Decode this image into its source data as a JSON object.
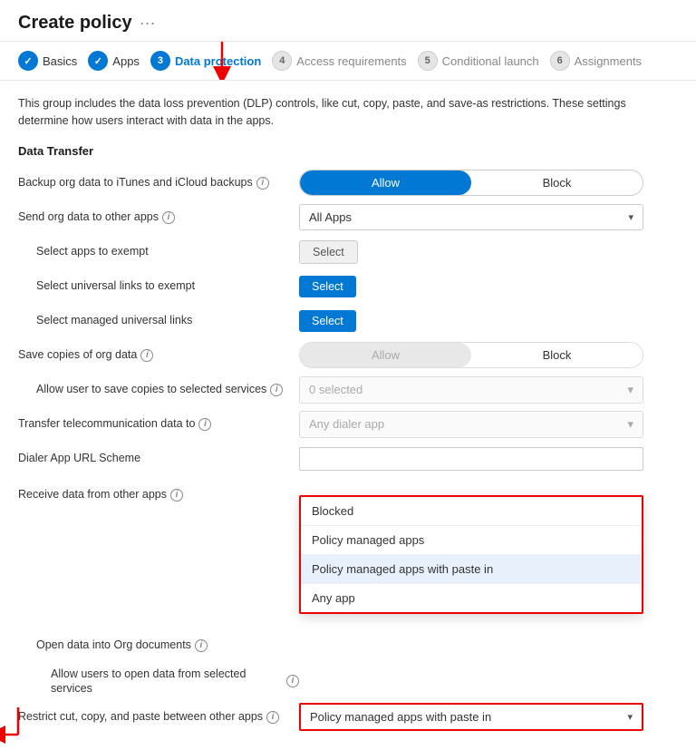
{
  "page": {
    "title": "Create policy",
    "ellipsis": "···"
  },
  "wizard": {
    "steps": [
      {
        "id": "basics",
        "number": "✓",
        "label": "Basics",
        "state": "done"
      },
      {
        "id": "apps",
        "number": "✓",
        "label": "Apps",
        "state": "done"
      },
      {
        "id": "data-protection",
        "number": "3",
        "label": "Data protection",
        "state": "active"
      },
      {
        "id": "access-requirements",
        "number": "4",
        "label": "Access requirements",
        "state": "inactive"
      },
      {
        "id": "conditional-launch",
        "number": "5",
        "label": "Conditional launch",
        "state": "inactive"
      },
      {
        "id": "assignments",
        "number": "6",
        "label": "Assignments",
        "state": "inactive"
      }
    ]
  },
  "description": "This group includes the data loss prevention (DLP) controls, like cut, copy, paste, and save-as restrictions. These settings determine how users interact with data in the apps.",
  "sections": {
    "data_transfer": {
      "title": "Data Transfer",
      "rows": [
        {
          "id": "backup-org-data",
          "label": "Backup org data to iTunes and iCloud backups",
          "hasInfo": true,
          "controlType": "toggle",
          "options": [
            "Allow",
            "Block"
          ],
          "activeOption": "Allow",
          "soft": false
        },
        {
          "id": "send-org-data",
          "label": "Send org data to other apps",
          "hasInfo": true,
          "controlType": "dropdown",
          "value": "All Apps"
        },
        {
          "id": "select-apps-exempt",
          "label": "Select apps to exempt",
          "hasInfo": false,
          "indent": 1,
          "controlType": "button-grey",
          "buttonLabel": "Select"
        },
        {
          "id": "select-universal-links",
          "label": "Select universal links to exempt",
          "hasInfo": false,
          "indent": 1,
          "controlType": "button-blue",
          "buttonLabel": "Select"
        },
        {
          "id": "select-managed-universal",
          "label": "Select managed universal links",
          "hasInfo": false,
          "indent": 1,
          "controlType": "button-blue",
          "buttonLabel": "Select"
        },
        {
          "id": "save-copies",
          "label": "Save copies of org data",
          "hasInfo": true,
          "controlType": "toggle",
          "options": [
            "Allow",
            "Block"
          ],
          "activeOption": "Allow",
          "soft": true
        },
        {
          "id": "allow-user-save-copies",
          "label": "Allow user to save copies to selected services",
          "hasInfo": true,
          "indent": 1,
          "controlType": "dropdown-disabled",
          "value": "0 selected"
        },
        {
          "id": "transfer-telecom",
          "label": "Transfer telecommunication data to",
          "hasInfo": true,
          "controlType": "dropdown-disabled",
          "value": "Any dialer app"
        },
        {
          "id": "dialer-url-scheme",
          "label": "Dialer App URL Scheme",
          "hasInfo": false,
          "controlType": "text-input",
          "value": ""
        }
      ]
    },
    "receive_data": {
      "title": "Receive data from other apps",
      "hasInfo": true,
      "rows": [
        {
          "id": "open-data-org",
          "label": "Open data into Org documents",
          "hasInfo": true,
          "indent": 1,
          "controlType": "none"
        },
        {
          "id": "allow-open-from-selected",
          "label": "Allow users to open data from selected services",
          "hasInfo": true,
          "indent": 2,
          "controlType": "none"
        }
      ]
    },
    "restrict_cut_copy": {
      "label": "Restrict cut, copy, and paste between other apps",
      "hasInfo": true
    }
  },
  "dropdown_panel": {
    "items": [
      {
        "id": "blocked",
        "label": "Blocked",
        "state": "normal"
      },
      {
        "id": "policy-managed",
        "label": "Policy managed apps",
        "state": "normal"
      },
      {
        "id": "policy-managed-paste",
        "label": "Policy managed apps with paste in",
        "state": "highlighted"
      },
      {
        "id": "any-app",
        "label": "Any app",
        "state": "normal"
      }
    ],
    "selected_value": "Policy managed apps with paste in"
  },
  "icons": {
    "chevron_down": "▾",
    "check": "✓",
    "info": "i"
  }
}
